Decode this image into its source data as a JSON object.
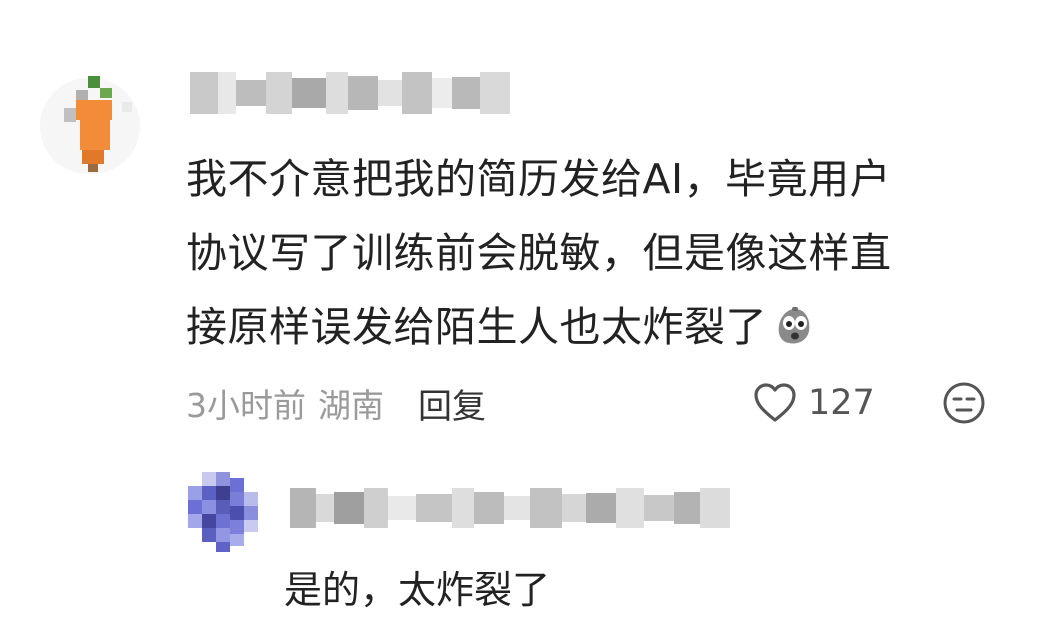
{
  "comment": {
    "text_lines": [
      "我不介意把我的简历发给AI，毕竟用户",
      "协议写了训练前会脱敏，但是像这样直",
      "接原样误发给陌生人也太炸裂了"
    ],
    "time": "3小时前",
    "location": "湖南",
    "reply_label": "回复",
    "like_count": "127",
    "inline_emoji_icon": "shocked-potato-emoji-icon",
    "like_icon": "heart-outline-icon",
    "reaction_icon": "neutral-face-icon"
  },
  "reply": {
    "text": "是的，太炸裂了"
  },
  "colors": {
    "text": "#222222",
    "meta": "#9a9a9a",
    "reply_label": "#333333",
    "avatar_carrot": "#f28c38",
    "avatar_leaf": "#4a8f3c",
    "avatar_blue": "#6b6fd6"
  }
}
